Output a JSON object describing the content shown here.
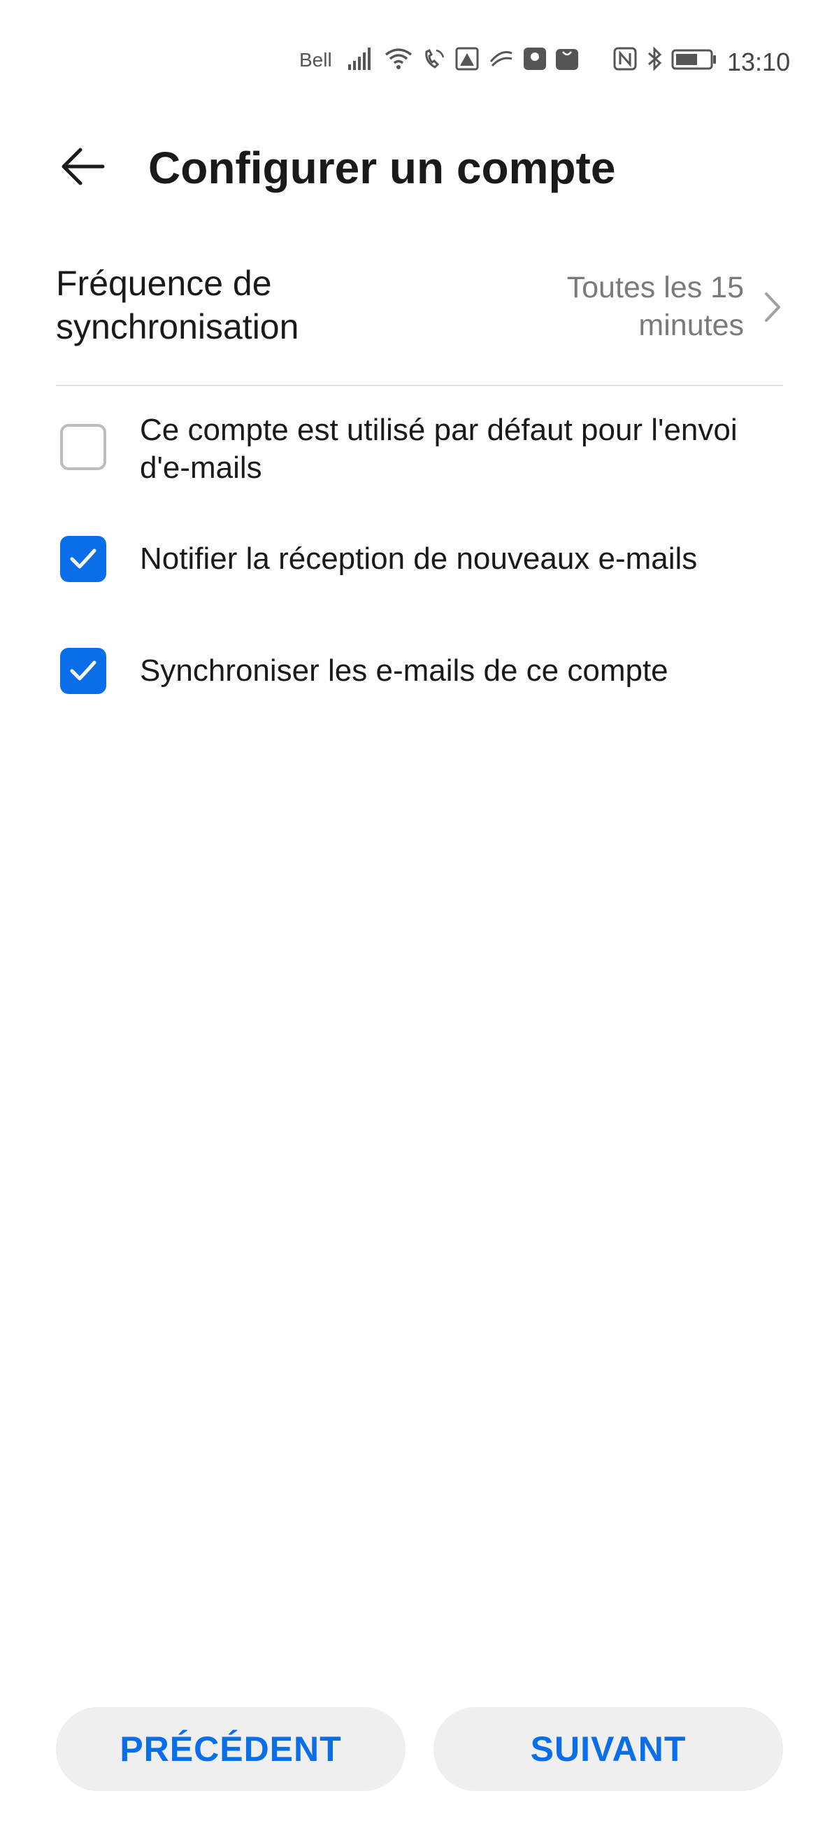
{
  "status_bar": {
    "carrier": "Bell",
    "time": "13:10",
    "icons": [
      "signal-icon",
      "wifi-icon",
      "wifi-calling-icon",
      "image-alert-icon",
      "swiftkey-icon",
      "huawei-icon",
      "huawei-store-icon",
      "nfc-icon",
      "bluetooth-icon",
      "battery-icon"
    ]
  },
  "header": {
    "back_icon": "arrow-left-icon",
    "title": "Configurer un compte"
  },
  "sync": {
    "label_line1": "Fréquence de",
    "label_line2": "synchronisation",
    "value_line1": "Toutes les 15",
    "value_line2": "minutes",
    "chevron_icon": "chevron-right-icon"
  },
  "options": [
    {
      "checked": false,
      "label_line1": "Ce compte est utilisé par défaut pour l'envoi",
      "label_line2": "d'e-mails"
    },
    {
      "checked": true,
      "label": "Notifier la réception de nouveaux e-mails"
    },
    {
      "checked": true,
      "label": "Synchroniser les e-mails de ce compte"
    }
  ],
  "footer": {
    "previous_label": "PRÉCÉDENT",
    "next_label": "SUIVANT"
  },
  "colors": {
    "accent": "#0a6ee8",
    "button_bg": "#efefef",
    "secondary_text": "#7a7a7a"
  }
}
